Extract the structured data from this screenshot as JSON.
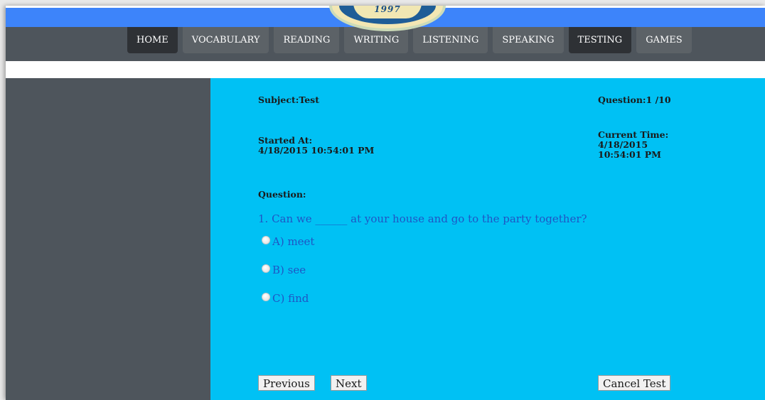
{
  "logo": {
    "year": "1997"
  },
  "nav": {
    "items": [
      {
        "label": "HOME",
        "active": true
      },
      {
        "label": "VOCABULARY",
        "active": false
      },
      {
        "label": "READING",
        "active": false
      },
      {
        "label": "WRITING",
        "active": false
      },
      {
        "label": "LISTENING",
        "active": false
      },
      {
        "label": "SPEAKING",
        "active": false
      },
      {
        "label": "TESTING",
        "active": true
      },
      {
        "label": "GAMES",
        "active": false
      }
    ]
  },
  "test": {
    "subject_label": "Subject:",
    "subject_value": "Test",
    "question_counter_label": "Question:",
    "question_counter_value": "1 /10",
    "started_label": "Started At:",
    "started_value": "4/18/2015 10:54:01 PM",
    "current_time_label": "Current Time:",
    "current_time_date": "4/18/2015",
    "current_time_clock": "10:54:01 PM",
    "question_heading": "Question:",
    "question_text": "1. Can we ______ at your house and go to the party together?",
    "options": [
      {
        "label": "A) meet",
        "selected": false
      },
      {
        "label": "B) see",
        "selected": false
      },
      {
        "label": "C) find",
        "selected": false
      }
    ]
  },
  "buttons": {
    "previous": "Previous",
    "next": "Next",
    "cancel": "Cancel Test"
  },
  "colors": {
    "top_bar": "#3d84fa",
    "nav_bar": "#4e555c",
    "content_bg": "#00c1f4",
    "question_text": "#1f56c4"
  }
}
